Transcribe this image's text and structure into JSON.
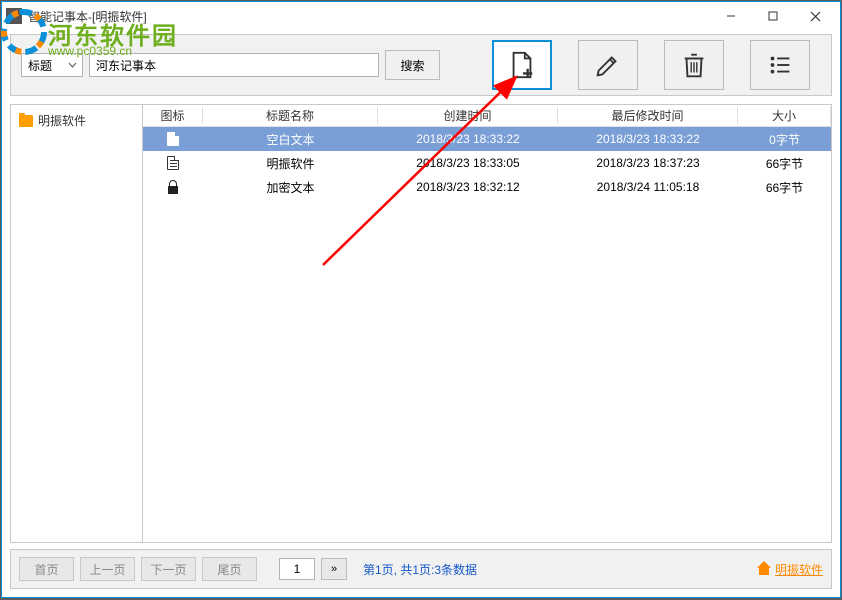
{
  "window": {
    "title": "智能记事本-[明振软件]"
  },
  "watermark": {
    "text1": "河东软件园",
    "text2": "www.pc0359.cn"
  },
  "toolbar": {
    "type_label": "标题",
    "search_value": "河东记事本",
    "search_btn": "搜索"
  },
  "sidebar": {
    "items": [
      {
        "label": "明振软件"
      }
    ]
  },
  "table": {
    "headers": {
      "icon": "图标",
      "title": "标题名称",
      "created": "创建时间",
      "modified": "最后修改时间",
      "size": "大小"
    },
    "rows": [
      {
        "icon": "doc",
        "title": "空白文本",
        "created": "2018/3/23 18:33:22",
        "modified": "2018/3/23 18:33:22",
        "size": "0字节",
        "selected": true
      },
      {
        "icon": "docl",
        "title": "明振软件",
        "created": "2018/3/23 18:33:05",
        "modified": "2018/3/23 18:37:23",
        "size": "66字节",
        "selected": false
      },
      {
        "icon": "lock",
        "title": "加密文本",
        "created": "2018/3/23 18:32:12",
        "modified": "2018/3/24 11:05:18",
        "size": "66字节",
        "selected": false
      }
    ]
  },
  "pager": {
    "first": "首页",
    "prev": "上一页",
    "next": "下一页",
    "last": "尾页",
    "page": "1",
    "go": "»",
    "status": "第1页, 共1页:3条数据",
    "link": "明振软件"
  }
}
